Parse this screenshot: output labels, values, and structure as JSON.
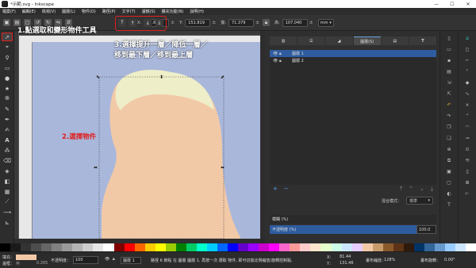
{
  "window": {
    "title": "*示範.svg - Inkscape",
    "minimize": "—",
    "maximize": "☐",
    "close": "✕"
  },
  "menu": [
    "檔案(F)",
    "編輯(E)",
    "檢視(V)",
    "圖層(L)",
    "物件(O)",
    "路徑(P)",
    "文字(T)",
    "濾鏡(S)",
    "擴充功能(N)",
    "說明(H)"
  ],
  "toolbar": {
    "x_label": "X:",
    "x_value": "64.652",
    "y_label": "Y:",
    "y_value": "151.819",
    "w_label": "寬:",
    "w_value": "71.379",
    "h_label": "高:",
    "h_value": "107.040",
    "unit": "mm"
  },
  "annotations": {
    "step1": "1.點選取和變形物件工具",
    "step2": "2.選擇物件",
    "step3_line1": "3.選擇提升一層／降低一層／",
    "step3_line2": "移到最下層／移到最上層"
  },
  "dock": {
    "tabs": [
      "",
      "",
      "",
      "圖層(S)",
      "",
      "T"
    ],
    "layers": [
      {
        "name": "圖層 1",
        "selected": true
      },
      {
        "name": "圖層 2",
        "selected": false
      }
    ],
    "add": "+",
    "remove": "−",
    "blend_label": "混合模式：",
    "blend_value": "標準",
    "blur_label": "模糊 (%)",
    "opacity_label": "不透明度 (%)",
    "opacity_value": "100.0"
  },
  "palette": [
    "#000000",
    "#1a1a1a",
    "#333333",
    "#4d4d4d",
    "#666666",
    "#808080",
    "#999999",
    "#b3b3b3",
    "#cccccc",
    "#e6e6e6",
    "#ffffff",
    "#800000",
    "#ff0000",
    "#ff6600",
    "#ffcc00",
    "#ffff00",
    "#99cc00",
    "#008000",
    "#00cc66",
    "#00ffcc",
    "#00ccff",
    "#0066ff",
    "#0000ff",
    "#6600cc",
    "#9900ff",
    "#cc00cc",
    "#ff00ff",
    "#ff66cc",
    "#ff9999",
    "#ffcccc",
    "#ffe6cc",
    "#e6ffcc",
    "#ccffe6",
    "#cce6ff",
    "#e6ccff",
    "#f2c9a7",
    "#c89b6d",
    "#8b5a2b",
    "#5c3317",
    "#2e1a0b",
    "#003366",
    "#336699",
    "#6699cc",
    "#99ccff",
    "#cce6ff",
    "#ffffff"
  ],
  "status": {
    "fill_label": "填充：",
    "stroke_label": "邊框：",
    "stroke_value": "無",
    "stroke_width": "0.265",
    "opacity_label": "不透明度：",
    "opacity_value": "100",
    "layer": "圖層 1",
    "message": "路徑 6 節點 在 圖層 圖層 1. 再按一次 選取 物件, 即可切換比例縮放/旋轉控制點.",
    "x_label": "X：",
    "x_value": "81.44",
    "y_label": "Y：",
    "y_value": "131.46",
    "zoom_label": "畫布縮放：",
    "zoom_value": "128%",
    "rotate_label": "畫布旋轉：",
    "rotate_value": "0.00°"
  },
  "colors": {
    "fill": "#f2c9a7",
    "top_shape": "#eeeec8",
    "page": "#a9b7db",
    "highlight": "#e02020",
    "selected_row": "#2e5c9e"
  }
}
